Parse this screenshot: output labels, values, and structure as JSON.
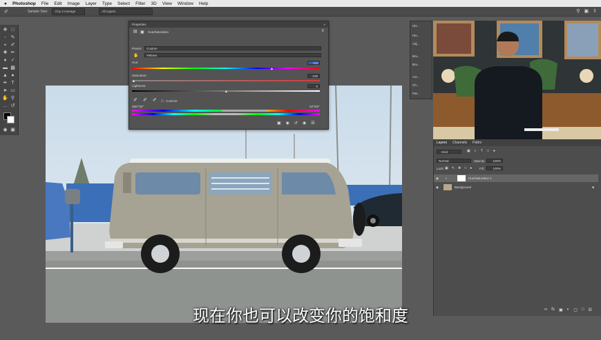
{
  "menubar": {
    "apple": "",
    "app": "Photoshop",
    "items": [
      "File",
      "Edit",
      "Image",
      "Layer",
      "Type",
      "Select",
      "Filter",
      "3D",
      "View",
      "Window",
      "Help"
    ]
  },
  "options": {
    "sample_size_label": "Sample Size:",
    "sample_size_value": "3 by 3 Average",
    "sample_layers_value": "All Layers"
  },
  "properties": {
    "title": "Properties",
    "subtitle": "Hue/Saturation",
    "preset_label": "Preset:",
    "preset_value": "Custom",
    "channel_value": "Yellows",
    "hue_label": "Hue:",
    "hue_value": "+53",
    "saturation_label": "Saturation:",
    "saturation_value": "-100",
    "lightness_label": "Lightness:",
    "lightness_value": "0",
    "colorize_label": "Colorize",
    "range_left": "355°/25°",
    "range_right": "52°/82°"
  },
  "mini_panel": {
    "items": [
      "His...",
      "His...",
      "Adj...",
      "Bru...",
      "Bru...",
      "Act...",
      "Ch...",
      "Pat..."
    ]
  },
  "layers": {
    "tabs": [
      "Layers",
      "Channels",
      "Paths"
    ],
    "kind_label": "Kind",
    "blend_mode": "Normal",
    "opacity_label": "Opacity:",
    "opacity_value": "100%",
    "lock_label": "Lock:",
    "fill_label": "Fill:",
    "fill_value": "100%",
    "rows": [
      {
        "name": "Hue/Saturation 1"
      },
      {
        "name": "Background"
      }
    ]
  },
  "subtitle": "现在你也可以改变你的饱和度",
  "colors": {
    "panel": "#535353",
    "accent": "#2f6fd0"
  }
}
